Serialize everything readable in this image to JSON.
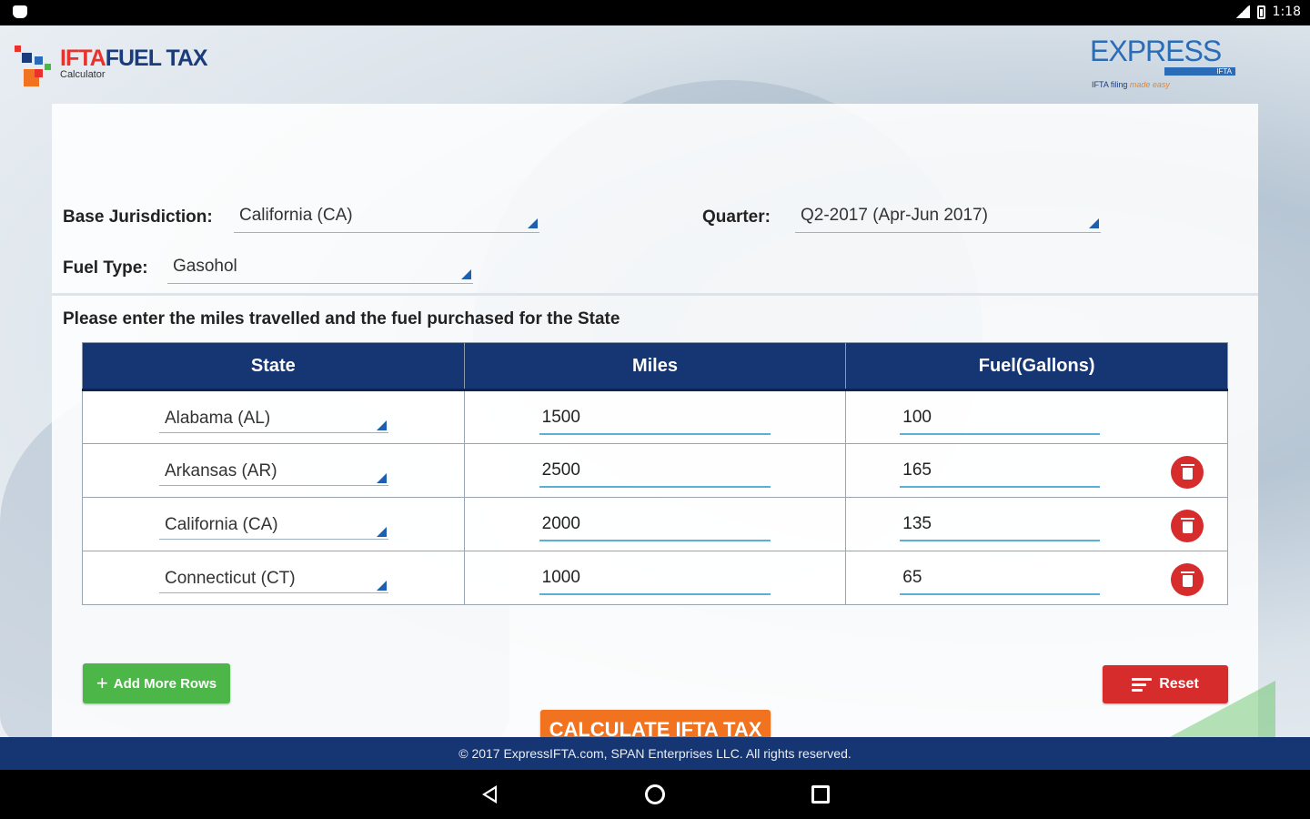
{
  "status": {
    "time": "1:18"
  },
  "header": {
    "logo_ifta": "IFTA",
    "logo_fuel_tax": "FUEL TAX",
    "logo_sub": "Calculator",
    "express_logo": "EXPRESS",
    "express_ifta": "IFTA",
    "express_tagline_1": "IFTA filing ",
    "express_tagline_2": "made easy"
  },
  "form": {
    "base_jurisdiction_label": "Base Jurisdiction:",
    "base_jurisdiction_value": "California (CA)",
    "quarter_label": "Quarter:",
    "quarter_value": "Q2-2017 (Apr-Jun 2017)",
    "fuel_type_label": "Fuel Type:",
    "fuel_type_value": "Gasohol",
    "instructions": "Please enter the miles travelled and the fuel purchased for the State"
  },
  "table": {
    "headers": [
      "State",
      "Miles",
      "Fuel(Gallons)"
    ],
    "rows": [
      {
        "state": "Alabama (AL)",
        "miles": "1500",
        "fuel": "100"
      },
      {
        "state": "Arkansas (AR)",
        "miles": "2500",
        "fuel": "165"
      },
      {
        "state": "California (CA)",
        "miles": "2000",
        "fuel": "135"
      },
      {
        "state": "Connecticut (CT)",
        "miles": "1000",
        "fuel": "65"
      }
    ]
  },
  "buttons": {
    "add_rows": "Add More Rows",
    "reset": "Reset",
    "calculate": "CALCULATE IFTA TAX"
  },
  "footer": {
    "copyright": "© 2017 ExpressIFTA.com, SPAN Enterprises LLC. All rights reserved."
  },
  "colors": {
    "navy": "#153672",
    "red": "#d72c2c",
    "green": "#4cb748",
    "orange": "#f1731f",
    "accent_blue": "#1f5fb0"
  }
}
